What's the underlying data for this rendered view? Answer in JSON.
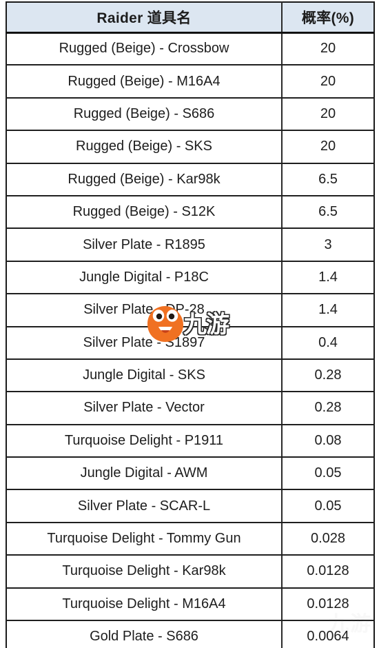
{
  "table": {
    "columns": [
      {
        "key": "name",
        "label": "Raider 道具名"
      },
      {
        "key": "rate",
        "label": "概率(%)"
      }
    ],
    "header_bg": "#DCE6F1",
    "rows": [
      {
        "name": "Rugged (Beige) - Crossbow",
        "rate": "20"
      },
      {
        "name": "Rugged (Beige) - M16A4",
        "rate": "20"
      },
      {
        "name": "Rugged (Beige) - S686",
        "rate": "20"
      },
      {
        "name": "Rugged (Beige) - SKS",
        "rate": "20"
      },
      {
        "name": "Rugged (Beige) - Kar98k",
        "rate": "6.5"
      },
      {
        "name": "Rugged (Beige) - S12K",
        "rate": "6.5"
      },
      {
        "name": "Silver Plate - R1895",
        "rate": "3"
      },
      {
        "name": "Jungle Digital - P18C",
        "rate": "1.4"
      },
      {
        "name": "Silver Plate - DP-28",
        "rate": "1.4"
      },
      {
        "name": "Silver Plate - S1897",
        "rate": "0.4"
      },
      {
        "name": "Jungle Digital - SKS",
        "rate": "0.28"
      },
      {
        "name": "Silver Plate - Vector",
        "rate": "0.28"
      },
      {
        "name": "Turquoise Delight - P1911",
        "rate": "0.08"
      },
      {
        "name": "Jungle Digital - AWM",
        "rate": "0.05"
      },
      {
        "name": "Silver Plate - SCAR-L",
        "rate": "0.05"
      },
      {
        "name": "Turquoise Delight - Tommy Gun",
        "rate": "0.028"
      },
      {
        "name": "Turquoise Delight - Kar98k",
        "rate": "0.0128"
      },
      {
        "name": "Turquoise Delight - M16A4",
        "rate": "0.0128"
      },
      {
        "name": "Gold Plate - S686",
        "rate": "0.0064"
      }
    ]
  },
  "watermark": {
    "text": "九游",
    "mascot_icon": "mascot-icon",
    "mascot_color": "#F07122",
    "faint_text": "九游"
  }
}
